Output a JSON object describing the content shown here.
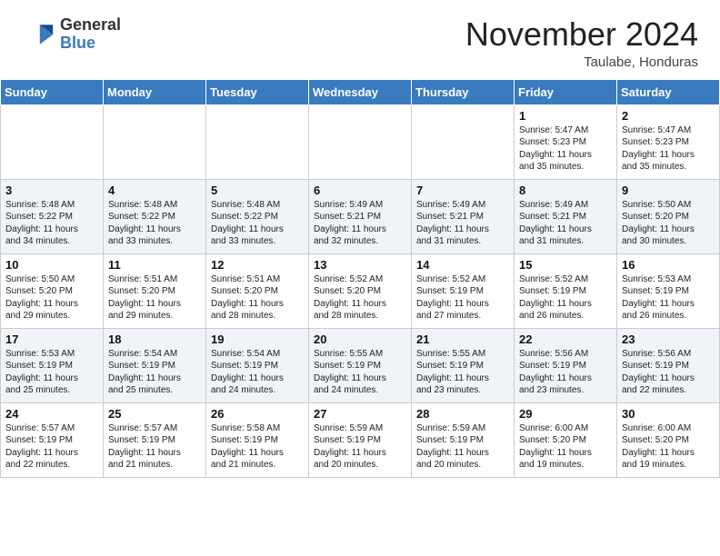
{
  "logo": {
    "general": "General",
    "blue": "Blue"
  },
  "header": {
    "month": "November 2024",
    "location": "Taulabe, Honduras"
  },
  "days_of_week": [
    "Sunday",
    "Monday",
    "Tuesday",
    "Wednesday",
    "Thursday",
    "Friday",
    "Saturday"
  ],
  "weeks": [
    [
      {
        "day": "",
        "content": ""
      },
      {
        "day": "",
        "content": ""
      },
      {
        "day": "",
        "content": ""
      },
      {
        "day": "",
        "content": ""
      },
      {
        "day": "",
        "content": ""
      },
      {
        "day": "1",
        "content": "Sunrise: 5:47 AM\nSunset: 5:23 PM\nDaylight: 11 hours\nand 35 minutes."
      },
      {
        "day": "2",
        "content": "Sunrise: 5:47 AM\nSunset: 5:23 PM\nDaylight: 11 hours\nand 35 minutes."
      }
    ],
    [
      {
        "day": "3",
        "content": "Sunrise: 5:48 AM\nSunset: 5:22 PM\nDaylight: 11 hours\nand 34 minutes."
      },
      {
        "day": "4",
        "content": "Sunrise: 5:48 AM\nSunset: 5:22 PM\nDaylight: 11 hours\nand 33 minutes."
      },
      {
        "day": "5",
        "content": "Sunrise: 5:48 AM\nSunset: 5:22 PM\nDaylight: 11 hours\nand 33 minutes."
      },
      {
        "day": "6",
        "content": "Sunrise: 5:49 AM\nSunset: 5:21 PM\nDaylight: 11 hours\nand 32 minutes."
      },
      {
        "day": "7",
        "content": "Sunrise: 5:49 AM\nSunset: 5:21 PM\nDaylight: 11 hours\nand 31 minutes."
      },
      {
        "day": "8",
        "content": "Sunrise: 5:49 AM\nSunset: 5:21 PM\nDaylight: 11 hours\nand 31 minutes."
      },
      {
        "day": "9",
        "content": "Sunrise: 5:50 AM\nSunset: 5:20 PM\nDaylight: 11 hours\nand 30 minutes."
      }
    ],
    [
      {
        "day": "10",
        "content": "Sunrise: 5:50 AM\nSunset: 5:20 PM\nDaylight: 11 hours\nand 29 minutes."
      },
      {
        "day": "11",
        "content": "Sunrise: 5:51 AM\nSunset: 5:20 PM\nDaylight: 11 hours\nand 29 minutes."
      },
      {
        "day": "12",
        "content": "Sunrise: 5:51 AM\nSunset: 5:20 PM\nDaylight: 11 hours\nand 28 minutes."
      },
      {
        "day": "13",
        "content": "Sunrise: 5:52 AM\nSunset: 5:20 PM\nDaylight: 11 hours\nand 28 minutes."
      },
      {
        "day": "14",
        "content": "Sunrise: 5:52 AM\nSunset: 5:19 PM\nDaylight: 11 hours\nand 27 minutes."
      },
      {
        "day": "15",
        "content": "Sunrise: 5:52 AM\nSunset: 5:19 PM\nDaylight: 11 hours\nand 26 minutes."
      },
      {
        "day": "16",
        "content": "Sunrise: 5:53 AM\nSunset: 5:19 PM\nDaylight: 11 hours\nand 26 minutes."
      }
    ],
    [
      {
        "day": "17",
        "content": "Sunrise: 5:53 AM\nSunset: 5:19 PM\nDaylight: 11 hours\nand 25 minutes."
      },
      {
        "day": "18",
        "content": "Sunrise: 5:54 AM\nSunset: 5:19 PM\nDaylight: 11 hours\nand 25 minutes."
      },
      {
        "day": "19",
        "content": "Sunrise: 5:54 AM\nSunset: 5:19 PM\nDaylight: 11 hours\nand 24 minutes."
      },
      {
        "day": "20",
        "content": "Sunrise: 5:55 AM\nSunset: 5:19 PM\nDaylight: 11 hours\nand 24 minutes."
      },
      {
        "day": "21",
        "content": "Sunrise: 5:55 AM\nSunset: 5:19 PM\nDaylight: 11 hours\nand 23 minutes."
      },
      {
        "day": "22",
        "content": "Sunrise: 5:56 AM\nSunset: 5:19 PM\nDaylight: 11 hours\nand 23 minutes."
      },
      {
        "day": "23",
        "content": "Sunrise: 5:56 AM\nSunset: 5:19 PM\nDaylight: 11 hours\nand 22 minutes."
      }
    ],
    [
      {
        "day": "24",
        "content": "Sunrise: 5:57 AM\nSunset: 5:19 PM\nDaylight: 11 hours\nand 22 minutes."
      },
      {
        "day": "25",
        "content": "Sunrise: 5:57 AM\nSunset: 5:19 PM\nDaylight: 11 hours\nand 21 minutes."
      },
      {
        "day": "26",
        "content": "Sunrise: 5:58 AM\nSunset: 5:19 PM\nDaylight: 11 hours\nand 21 minutes."
      },
      {
        "day": "27",
        "content": "Sunrise: 5:59 AM\nSunset: 5:19 PM\nDaylight: 11 hours\nand 20 minutes."
      },
      {
        "day": "28",
        "content": "Sunrise: 5:59 AM\nSunset: 5:19 PM\nDaylight: 11 hours\nand 20 minutes."
      },
      {
        "day": "29",
        "content": "Sunrise: 6:00 AM\nSunset: 5:20 PM\nDaylight: 11 hours\nand 19 minutes."
      },
      {
        "day": "30",
        "content": "Sunrise: 6:00 AM\nSunset: 5:20 PM\nDaylight: 11 hours\nand 19 minutes."
      }
    ]
  ]
}
